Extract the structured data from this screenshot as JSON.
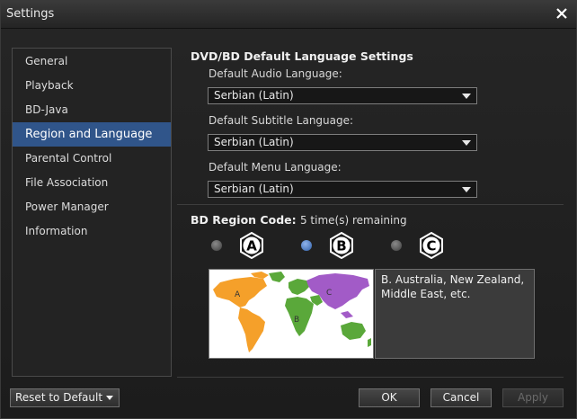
{
  "window": {
    "title": "Settings"
  },
  "sidebar": {
    "items": [
      {
        "label": "General"
      },
      {
        "label": "Playback"
      },
      {
        "label": "BD-Java"
      },
      {
        "label": "Region and Language",
        "selected": true
      },
      {
        "label": "Parental Control"
      },
      {
        "label": "File Association"
      },
      {
        "label": "Power Manager"
      },
      {
        "label": "Information"
      }
    ]
  },
  "language": {
    "section_title": "DVD/BD Default Language Settings",
    "audio_label": "Default Audio Language:",
    "audio_value": "Serbian (Latin)",
    "subtitle_label": "Default Subtitle Language:",
    "subtitle_value": "Serbian (Latin)",
    "menu_label": "Default Menu Language:",
    "menu_value": "Serbian (Latin)"
  },
  "region": {
    "section_title": "BD Region Code:",
    "remaining": "5 time(s) remaining",
    "options": [
      {
        "letter": "A",
        "selected": false
      },
      {
        "letter": "B",
        "selected": true
      },
      {
        "letter": "C",
        "selected": false
      }
    ],
    "map_labels": [
      "A",
      "B",
      "C"
    ],
    "description": "B. Australia, New Zealand, Middle East, etc."
  },
  "footer": {
    "reset_label": "Reset to Default",
    "ok_label": "OK",
    "cancel_label": "Cancel",
    "apply_label": "Apply"
  },
  "colors": {
    "selected_nav": "#30558a",
    "region_a": "#f5a02a",
    "region_b": "#5aa83a",
    "region_c": "#a25bc7"
  }
}
